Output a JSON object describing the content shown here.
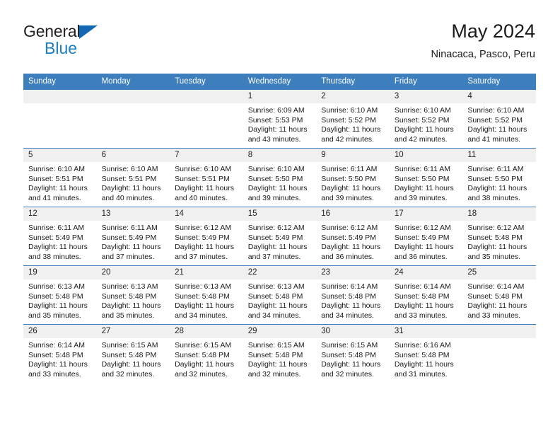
{
  "brand": {
    "name_top": "General",
    "name_bottom": "Blue",
    "triangle_icon": "triangle-icon",
    "accent_color": "#1b7dc4"
  },
  "header": {
    "title": "May 2024",
    "subtitle": "Ninacaca, Pasco, Peru"
  },
  "theme": {
    "header_bg": "#3d7ebd",
    "header_text": "#ffffff",
    "daynum_bg": "#f0f0f0",
    "row_divider": "#3d7ebd"
  },
  "weekday_headers": [
    "Sunday",
    "Monday",
    "Tuesday",
    "Wednesday",
    "Thursday",
    "Friday",
    "Saturday"
  ],
  "labels": {
    "sunrise_prefix": "Sunrise:",
    "sunset_prefix": "Sunset:",
    "daylight_prefix": "Daylight:"
  },
  "weeks": [
    [
      {
        "day": "",
        "empty": true,
        "sunrise": "",
        "sunset": "",
        "daylight_line1": "",
        "daylight_line2": ""
      },
      {
        "day": "",
        "empty": true,
        "sunrise": "",
        "sunset": "",
        "daylight_line1": "",
        "daylight_line2": ""
      },
      {
        "day": "",
        "empty": true,
        "sunrise": "",
        "sunset": "",
        "daylight_line1": "",
        "daylight_line2": ""
      },
      {
        "day": "1",
        "empty": false,
        "sunrise": "Sunrise: 6:09 AM",
        "sunset": "Sunset: 5:53 PM",
        "daylight_line1": "Daylight: 11 hours",
        "daylight_line2": "and 43 minutes."
      },
      {
        "day": "2",
        "empty": false,
        "sunrise": "Sunrise: 6:10 AM",
        "sunset": "Sunset: 5:52 PM",
        "daylight_line1": "Daylight: 11 hours",
        "daylight_line2": "and 42 minutes."
      },
      {
        "day": "3",
        "empty": false,
        "sunrise": "Sunrise: 6:10 AM",
        "sunset": "Sunset: 5:52 PM",
        "daylight_line1": "Daylight: 11 hours",
        "daylight_line2": "and 42 minutes."
      },
      {
        "day": "4",
        "empty": false,
        "sunrise": "Sunrise: 6:10 AM",
        "sunset": "Sunset: 5:52 PM",
        "daylight_line1": "Daylight: 11 hours",
        "daylight_line2": "and 41 minutes."
      }
    ],
    [
      {
        "day": "5",
        "empty": false,
        "sunrise": "Sunrise: 6:10 AM",
        "sunset": "Sunset: 5:51 PM",
        "daylight_line1": "Daylight: 11 hours",
        "daylight_line2": "and 41 minutes."
      },
      {
        "day": "6",
        "empty": false,
        "sunrise": "Sunrise: 6:10 AM",
        "sunset": "Sunset: 5:51 PM",
        "daylight_line1": "Daylight: 11 hours",
        "daylight_line2": "and 40 minutes."
      },
      {
        "day": "7",
        "empty": false,
        "sunrise": "Sunrise: 6:10 AM",
        "sunset": "Sunset: 5:51 PM",
        "daylight_line1": "Daylight: 11 hours",
        "daylight_line2": "and 40 minutes."
      },
      {
        "day": "8",
        "empty": false,
        "sunrise": "Sunrise: 6:10 AM",
        "sunset": "Sunset: 5:50 PM",
        "daylight_line1": "Daylight: 11 hours",
        "daylight_line2": "and 39 minutes."
      },
      {
        "day": "9",
        "empty": false,
        "sunrise": "Sunrise: 6:11 AM",
        "sunset": "Sunset: 5:50 PM",
        "daylight_line1": "Daylight: 11 hours",
        "daylight_line2": "and 39 minutes."
      },
      {
        "day": "10",
        "empty": false,
        "sunrise": "Sunrise: 6:11 AM",
        "sunset": "Sunset: 5:50 PM",
        "daylight_line1": "Daylight: 11 hours",
        "daylight_line2": "and 39 minutes."
      },
      {
        "day": "11",
        "empty": false,
        "sunrise": "Sunrise: 6:11 AM",
        "sunset": "Sunset: 5:50 PM",
        "daylight_line1": "Daylight: 11 hours",
        "daylight_line2": "and 38 minutes."
      }
    ],
    [
      {
        "day": "12",
        "empty": false,
        "sunrise": "Sunrise: 6:11 AM",
        "sunset": "Sunset: 5:49 PM",
        "daylight_line1": "Daylight: 11 hours",
        "daylight_line2": "and 38 minutes."
      },
      {
        "day": "13",
        "empty": false,
        "sunrise": "Sunrise: 6:11 AM",
        "sunset": "Sunset: 5:49 PM",
        "daylight_line1": "Daylight: 11 hours",
        "daylight_line2": "and 37 minutes."
      },
      {
        "day": "14",
        "empty": false,
        "sunrise": "Sunrise: 6:12 AM",
        "sunset": "Sunset: 5:49 PM",
        "daylight_line1": "Daylight: 11 hours",
        "daylight_line2": "and 37 minutes."
      },
      {
        "day": "15",
        "empty": false,
        "sunrise": "Sunrise: 6:12 AM",
        "sunset": "Sunset: 5:49 PM",
        "daylight_line1": "Daylight: 11 hours",
        "daylight_line2": "and 37 minutes."
      },
      {
        "day": "16",
        "empty": false,
        "sunrise": "Sunrise: 6:12 AM",
        "sunset": "Sunset: 5:49 PM",
        "daylight_line1": "Daylight: 11 hours",
        "daylight_line2": "and 36 minutes."
      },
      {
        "day": "17",
        "empty": false,
        "sunrise": "Sunrise: 6:12 AM",
        "sunset": "Sunset: 5:49 PM",
        "daylight_line1": "Daylight: 11 hours",
        "daylight_line2": "and 36 minutes."
      },
      {
        "day": "18",
        "empty": false,
        "sunrise": "Sunrise: 6:12 AM",
        "sunset": "Sunset: 5:48 PM",
        "daylight_line1": "Daylight: 11 hours",
        "daylight_line2": "and 35 minutes."
      }
    ],
    [
      {
        "day": "19",
        "empty": false,
        "sunrise": "Sunrise: 6:13 AM",
        "sunset": "Sunset: 5:48 PM",
        "daylight_line1": "Daylight: 11 hours",
        "daylight_line2": "and 35 minutes."
      },
      {
        "day": "20",
        "empty": false,
        "sunrise": "Sunrise: 6:13 AM",
        "sunset": "Sunset: 5:48 PM",
        "daylight_line1": "Daylight: 11 hours",
        "daylight_line2": "and 35 minutes."
      },
      {
        "day": "21",
        "empty": false,
        "sunrise": "Sunrise: 6:13 AM",
        "sunset": "Sunset: 5:48 PM",
        "daylight_line1": "Daylight: 11 hours",
        "daylight_line2": "and 34 minutes."
      },
      {
        "day": "22",
        "empty": false,
        "sunrise": "Sunrise: 6:13 AM",
        "sunset": "Sunset: 5:48 PM",
        "daylight_line1": "Daylight: 11 hours",
        "daylight_line2": "and 34 minutes."
      },
      {
        "day": "23",
        "empty": false,
        "sunrise": "Sunrise: 6:14 AM",
        "sunset": "Sunset: 5:48 PM",
        "daylight_line1": "Daylight: 11 hours",
        "daylight_line2": "and 34 minutes."
      },
      {
        "day": "24",
        "empty": false,
        "sunrise": "Sunrise: 6:14 AM",
        "sunset": "Sunset: 5:48 PM",
        "daylight_line1": "Daylight: 11 hours",
        "daylight_line2": "and 33 minutes."
      },
      {
        "day": "25",
        "empty": false,
        "sunrise": "Sunrise: 6:14 AM",
        "sunset": "Sunset: 5:48 PM",
        "daylight_line1": "Daylight: 11 hours",
        "daylight_line2": "and 33 minutes."
      }
    ],
    [
      {
        "day": "26",
        "empty": false,
        "sunrise": "Sunrise: 6:14 AM",
        "sunset": "Sunset: 5:48 PM",
        "daylight_line1": "Daylight: 11 hours",
        "daylight_line2": "and 33 minutes."
      },
      {
        "day": "27",
        "empty": false,
        "sunrise": "Sunrise: 6:15 AM",
        "sunset": "Sunset: 5:48 PM",
        "daylight_line1": "Daylight: 11 hours",
        "daylight_line2": "and 32 minutes."
      },
      {
        "day": "28",
        "empty": false,
        "sunrise": "Sunrise: 6:15 AM",
        "sunset": "Sunset: 5:48 PM",
        "daylight_line1": "Daylight: 11 hours",
        "daylight_line2": "and 32 minutes."
      },
      {
        "day": "29",
        "empty": false,
        "sunrise": "Sunrise: 6:15 AM",
        "sunset": "Sunset: 5:48 PM",
        "daylight_line1": "Daylight: 11 hours",
        "daylight_line2": "and 32 minutes."
      },
      {
        "day": "30",
        "empty": false,
        "sunrise": "Sunrise: 6:15 AM",
        "sunset": "Sunset: 5:48 PM",
        "daylight_line1": "Daylight: 11 hours",
        "daylight_line2": "and 32 minutes."
      },
      {
        "day": "31",
        "empty": false,
        "sunrise": "Sunrise: 6:16 AM",
        "sunset": "Sunset: 5:48 PM",
        "daylight_line1": "Daylight: 11 hours",
        "daylight_line2": "and 31 minutes."
      },
      {
        "day": "",
        "empty": true,
        "sunrise": "",
        "sunset": "",
        "daylight_line1": "",
        "daylight_line2": ""
      }
    ]
  ]
}
